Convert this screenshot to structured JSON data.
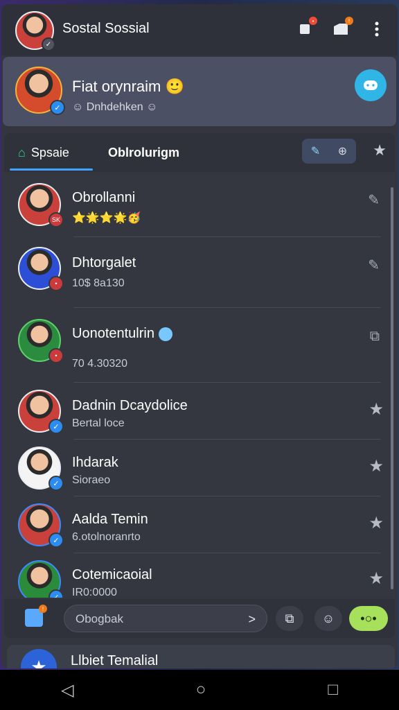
{
  "header": {
    "title": "Sostal Sossial",
    "icons": [
      "profile-avatar",
      "bookmark-icon",
      "folder-icon",
      "more-icon"
    ]
  },
  "profile": {
    "name": "Fiat orynraim",
    "emoji": "🙂",
    "sub_prefix": "☺",
    "sub_text": "Dnhdehken",
    "sub_suffix": "☺"
  },
  "tabs": {
    "home_label": "Spsaie",
    "second_label": "Oblrolurigm"
  },
  "contacts": [
    {
      "name": "Obrollanni",
      "sub": "",
      "emojis": "⭐🌟⭐🌟🥳",
      "badge": "SK",
      "action": "edit",
      "verified": false
    },
    {
      "name": "Dhtorgalet",
      "sub": "10$ 8a130",
      "emojis": "",
      "badge": "",
      "action": "edit",
      "verified": false
    },
    {
      "name": "Uonotentulrin",
      "sub": "70 4.30320",
      "emojis": "",
      "badge": "",
      "action": "share",
      "verified": false
    },
    {
      "name": "Dadnin Dcaydolice",
      "sub": "Bertal loce",
      "emojis": "",
      "badge": "",
      "action": "star",
      "verified": true
    },
    {
      "name": "Ihdarak",
      "sub": "Sioraeo",
      "emojis": "",
      "badge": "",
      "action": "star",
      "verified": true
    },
    {
      "name": "Aalda Temin",
      "sub": "6.otolnoranrto",
      "emojis": "",
      "badge": "",
      "action": "star",
      "verified": true
    },
    {
      "name": "Cotemicaoial",
      "sub": "IR0:0000",
      "emojis": "",
      "badge": "",
      "action": "star",
      "verified": true
    }
  ],
  "composer": {
    "placeholder": "Obogbak",
    "send_icon": ">"
  },
  "bottom_card": {
    "title": "Llbiet Temalial"
  },
  "colors": {
    "accent": "#2fb6e6",
    "pill": "#a7e15c",
    "verified": "#2d8cf0"
  }
}
